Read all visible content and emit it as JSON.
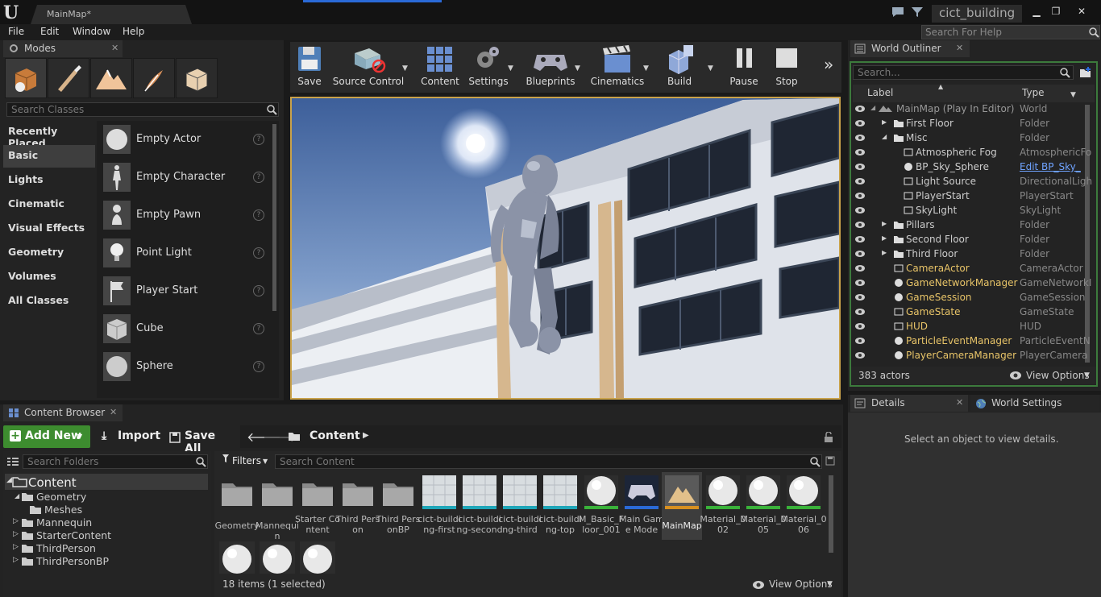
{
  "title": {
    "map_tab": "MainMap*",
    "project": "cict_building"
  },
  "menu": [
    "File",
    "Edit",
    "Window",
    "Help"
  ],
  "help_search_placeholder": "Search For Help",
  "modes": {
    "tab": "Modes",
    "search_placeholder": "Search Classes",
    "categories": [
      "Recently Placed",
      "Basic",
      "Lights",
      "Cinematic",
      "Visual Effects",
      "Geometry",
      "Volumes",
      "All Classes"
    ],
    "selected_category": "Basic",
    "items": [
      "Empty Actor",
      "Empty Character",
      "Empty Pawn",
      "Point Light",
      "Player Start",
      "Cube",
      "Sphere"
    ],
    "help_glyph": "?"
  },
  "toolbar": {
    "buttons": [
      "Save",
      "Source Control",
      "Content",
      "Settings",
      "Blueprints",
      "Cinematics",
      "Build",
      "Pause",
      "Stop"
    ],
    "overflow": "»"
  },
  "outliner": {
    "tab": "World Outliner",
    "search_placeholder": "Search...",
    "col_label": "Label",
    "col_type": "Type",
    "rows": [
      {
        "label": "MainMap (Play In Editor)",
        "type": "World"
      },
      {
        "label": "First Floor",
        "type": "Folder"
      },
      {
        "label": "Misc",
        "type": "Folder"
      },
      {
        "label": "Atmospheric Fog",
        "type": "AtmosphericFo"
      },
      {
        "label": "BP_Sky_Sphere",
        "type": "Edit BP_Sky_"
      },
      {
        "label": "Light Source",
        "type": "DirectionalLigh"
      },
      {
        "label": "PlayerStart",
        "type": "PlayerStart"
      },
      {
        "label": "SkyLight",
        "type": "SkyLight"
      },
      {
        "label": "Pillars",
        "type": "Folder"
      },
      {
        "label": "Second Floor",
        "type": "Folder"
      },
      {
        "label": "Third Floor",
        "type": "Folder"
      },
      {
        "label": "CameraActor",
        "type": "CameraActor"
      },
      {
        "label": "GameNetworkManager",
        "type": "GameNetworkI"
      },
      {
        "label": "GameSession",
        "type": "GameSession"
      },
      {
        "label": "GameState",
        "type": "GameState"
      },
      {
        "label": "HUD",
        "type": "HUD"
      },
      {
        "label": "ParticleEventManager",
        "type": "ParticleEventN"
      },
      {
        "label": "PlayerCameraManager",
        "type": "PlayerCamera"
      }
    ],
    "count": "383 actors",
    "view_options": "View Options"
  },
  "details": {
    "tab": "Details",
    "tab2": "World Settings",
    "empty": "Select an object to view details."
  },
  "content_browser": {
    "tab": "Content Browser",
    "add_new": "Add New",
    "import": "Import",
    "save_all": "Save All",
    "path": "Content",
    "search_folders": "Search Folders",
    "filters": "Filters",
    "search_content": "Search Content",
    "tree": [
      "Content",
      "Geometry",
      "Meshes",
      "Mannequin",
      "StarterContent",
      "ThirdPerson",
      "ThirdPersonBP"
    ],
    "assets": [
      "Geometry",
      "Mannequin",
      "Starter Content",
      "Third Person",
      "Third PersonBP",
      "cict-building-first",
      "cict-building-second",
      "cict-building-third",
      "cict-building-top",
      "M_Basic_Floor_001",
      "Main Game Mode",
      "MainMap",
      "Material_002",
      "Material_005",
      "Material_006"
    ],
    "status": "18 items (1 selected)",
    "view_options": "View Options"
  },
  "colors": {
    "accent": "#c9a24a",
    "add_new": "#3d8c2f",
    "actor_label": "#e8c468",
    "link": "#6fa3ff",
    "selection": "#2a6ad8"
  }
}
